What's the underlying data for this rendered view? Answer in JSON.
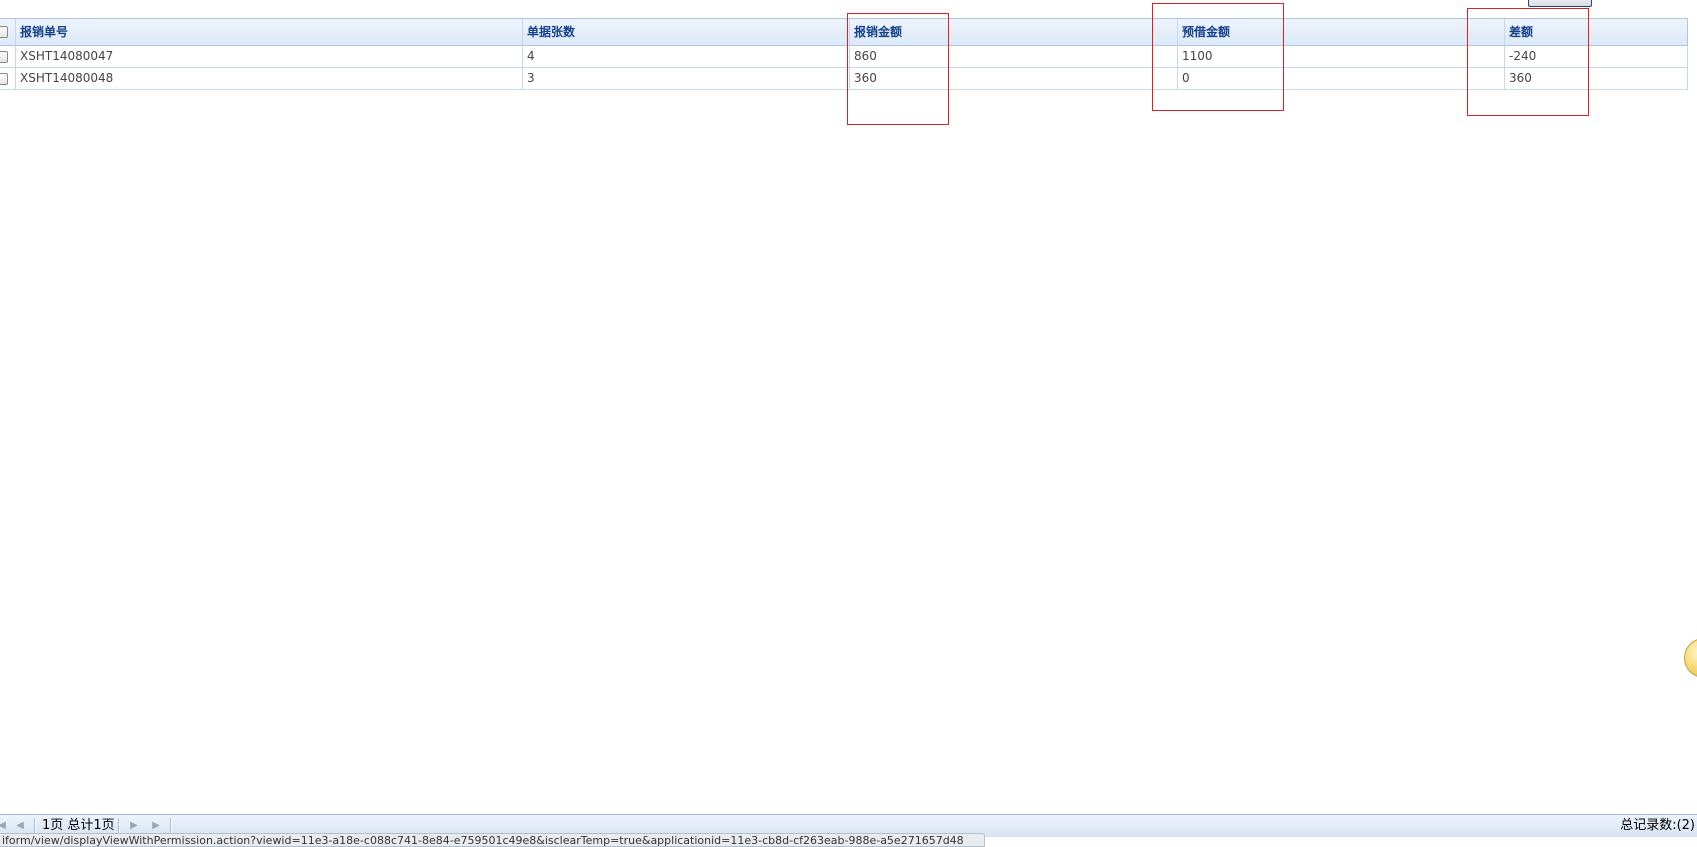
{
  "grid": {
    "columns": [
      {
        "label": "报销单号"
      },
      {
        "label": "单据张数"
      },
      {
        "label": "报销金额"
      },
      {
        "label": "预借金额"
      },
      {
        "label": "差额"
      }
    ],
    "rows": [
      {
        "no": "XSHT14080047",
        "count": "4",
        "reimburse": "860",
        "advance": "1100",
        "diff": "-240"
      },
      {
        "no": "XSHT14080048",
        "count": "3",
        "reimburse": "360",
        "advance": "0",
        "diff": "360"
      }
    ]
  },
  "paging": {
    "first_icon": "first-page-icon",
    "prev_icon": "prev-page-icon",
    "next_icon": "next-page-icon",
    "last_icon": "last-page-icon",
    "page_info": "1页 总计1页",
    "total_records": "总记录数:(2)"
  },
  "status_url": "iform/view/displayViewWithPermission.action?viewid=11e3-a18e-c088c741-8e84-e759501c49e8&isclearTemp=true&applicationid=11e3-cb8d-cf263eab-988e-a5e271657d48",
  "colors": {
    "header_text": "#15428b",
    "annotation": "#e02020",
    "grid_border": "#aec7e8"
  }
}
